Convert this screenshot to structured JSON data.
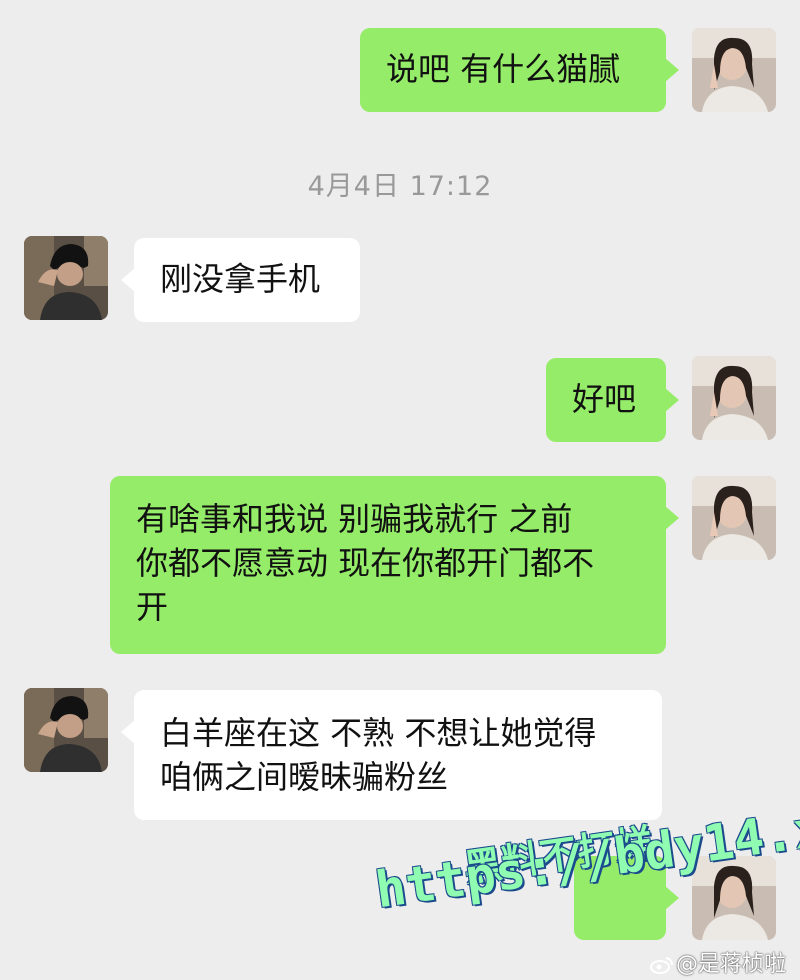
{
  "chat": {
    "timestamp": "4月4日 17:12",
    "messages": [
      {
        "sender": "me",
        "text": "说吧 有什么猫腻"
      },
      {
        "sender": "other",
        "text": "刚没拿手机"
      },
      {
        "sender": "me",
        "text": "好吧"
      },
      {
        "sender": "me",
        "lines": [
          "有啥事和我说 别骗我就行 之前",
          "你都不愿意动 现在你都开门都不",
          "开"
        ]
      },
      {
        "sender": "other",
        "lines": [
          "白羊座在这 不熟 不想让她觉得",
          "咱俩之间暧昧骗粉丝"
        ]
      },
      {
        "sender": "me",
        "text": ""
      }
    ]
  },
  "watermark": {
    "line1": "黑料不打烊",
    "line2": "https://bdy14.xyz"
  },
  "credit": "@是蒋桢啦",
  "colors": {
    "background": "#ededed",
    "my_bubble": "#95ec69",
    "other_bubble": "#ffffff",
    "timestamp": "#999999"
  }
}
